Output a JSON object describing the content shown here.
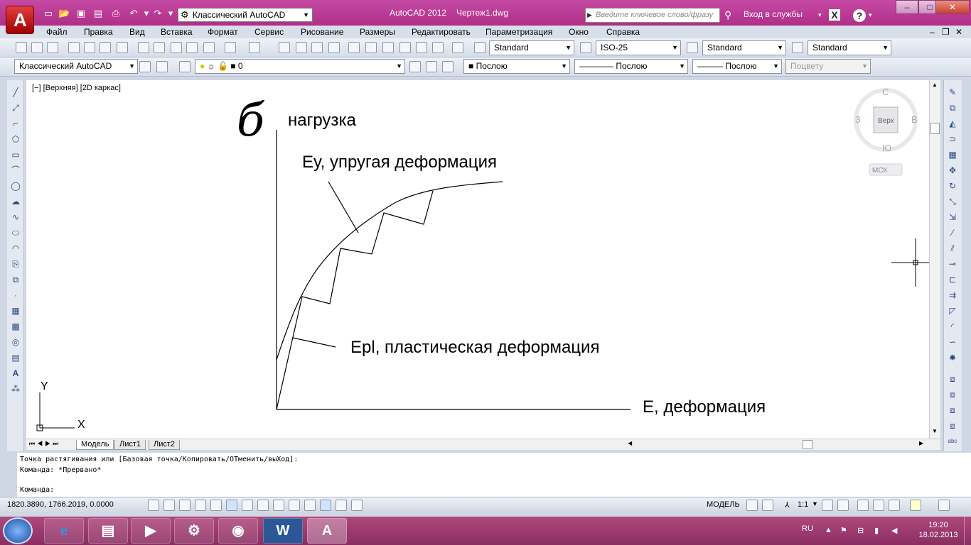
{
  "titlebar": {
    "workspace": "Классический AutoCAD",
    "app_title": "AutoCAD 2012",
    "doc_title": "Чертеж1.dwg",
    "search_placeholder": "Введите ключевое слово/фразу",
    "signin": "Вход в службы",
    "minimize": "–",
    "maximize": "□",
    "close": "✕"
  },
  "menu": [
    "Файл",
    "Правка",
    "Вид",
    "Вставка",
    "Формат",
    "Сервис",
    "Рисование",
    "Размеры",
    "Редактировать",
    "Параметризация",
    "Окно",
    "Справка"
  ],
  "toolbar_styles": {
    "text_style": "Standard",
    "dim_style": "ISO-25",
    "table_style": "Standard",
    "mleader_style": "Standard"
  },
  "toolbar_layers": {
    "workspace": "Классический AutoCAD",
    "layer": "0",
    "color": "Послою",
    "linetype": "Послою",
    "lineweight": "Послою",
    "plotstyle": "Поцвету"
  },
  "viewport": {
    "label": "[−] [Верхняя] [2D каркас]",
    "viewcube_top": "Верх",
    "compass_n": "С",
    "compass_s": "Ю",
    "compass_w": "З",
    "compass_e": "В",
    "ucs_label": "МСК"
  },
  "drawing": {
    "sigma": "б",
    "y_axis_label": "нагрузка",
    "elastic_label": "Eу, упругая деформация",
    "plastic_label": "Epl, пластическая деформация",
    "x_axis_label": "E, деформация",
    "ucs_x": "X",
    "ucs_y": "Y"
  },
  "tabs": [
    "Модель",
    "Лист1",
    "Лист2"
  ],
  "command": {
    "line1": "Точка растягивания или [Базовая точка/Копировать/ОТменить/выХод]:",
    "line2": "Команда: *Прервано*",
    "prompt": "Команда:"
  },
  "status": {
    "coords": "1820.3890, 1766.2019, 0.0000",
    "space": "МОДЕЛЬ",
    "scale": "1:1"
  },
  "taskbar": {
    "lang": "RU",
    "time": "19:20",
    "date": "18.02.2013"
  }
}
